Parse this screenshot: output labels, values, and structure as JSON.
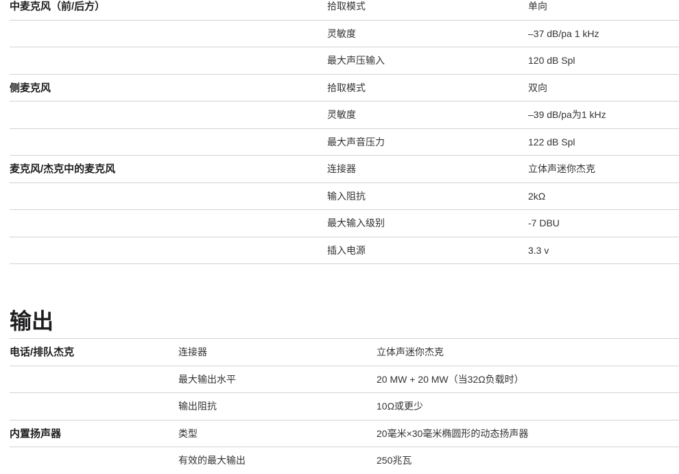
{
  "mic_table": [
    {
      "group": "中麦克风（前/后方）",
      "param": "拾取模式",
      "value": "单向"
    },
    {
      "group": "",
      "param": "灵敏度",
      "value": "–37 dB/pa 1 kHz"
    },
    {
      "group": "",
      "param": "最大声压输入",
      "value": "120 dB Spl"
    },
    {
      "group": "侧麦克风",
      "param": "拾取模式",
      "value": "双向"
    },
    {
      "group": "",
      "param": "灵敏度",
      "value": "–39 dB/pa为1 kHz"
    },
    {
      "group": "",
      "param": "最大声音压力",
      "value": "122 dB Spl"
    },
    {
      "group": "麦克风/杰克中的麦克风",
      "param": "连接器",
      "value": "立体声迷你杰克"
    },
    {
      "group": "",
      "param": "输入阻抗",
      "value": "2kΩ"
    },
    {
      "group": "",
      "param": "最大输入级别",
      "value": "-7 DBU"
    },
    {
      "group": "",
      "param": "插入电源",
      "value": "3.3 v"
    }
  ],
  "output_section": {
    "title": "输出",
    "rows": [
      {
        "group": "电话/排队杰克",
        "param": "连接器",
        "value": "立体声迷你杰克"
      },
      {
        "group": "",
        "param": "最大输出水平",
        "value": "20 MW + 20 MW（当32Ω负载时）"
      },
      {
        "group": "",
        "param": "输出阻抗",
        "value": "10Ω或更少"
      },
      {
        "group": "内置扬声器",
        "param": "类型",
        "value": "20毫米×30毫米椭圆形的动态扬声器"
      },
      {
        "group": "",
        "param": "有效的最大输出",
        "value": "250兆瓦"
      }
    ]
  }
}
